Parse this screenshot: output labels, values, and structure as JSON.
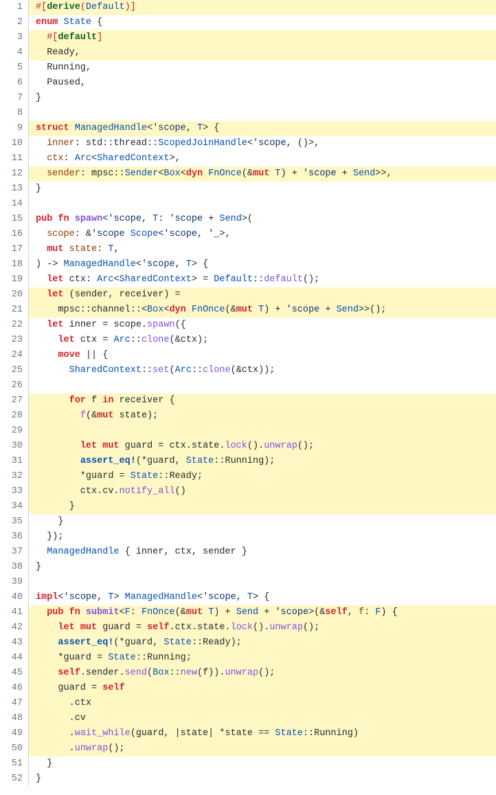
{
  "line_count": 52,
  "highlighted_lines": [
    1,
    3,
    4,
    9,
    12,
    20,
    21,
    27,
    28,
    29,
    30,
    31,
    32,
    33,
    34,
    41,
    42,
    43,
    44,
    45,
    46,
    47,
    48,
    49,
    50
  ],
  "lines": [
    {
      "n": 1,
      "t": [
        {
          "v": "a",
          "s": "#["
        },
        {
          "v": "f",
          "s": "derive"
        },
        {
          "v": "a",
          "s": "("
        },
        {
          "v": "c",
          "s": "Default"
        },
        {
          "v": "a",
          "s": ")]"
        }
      ]
    },
    {
      "n": 2,
      "t": [
        {
          "v": "b",
          "s": "enum"
        },
        {
          "s": " "
        },
        {
          "v": "c",
          "s": "State"
        },
        {
          "s": " {"
        }
      ]
    },
    {
      "n": 3,
      "t": [
        {
          "s": "  "
        },
        {
          "v": "a",
          "s": "#["
        },
        {
          "v": "f",
          "s": "default"
        },
        {
          "v": "a",
          "s": "]"
        }
      ]
    },
    {
      "n": 4,
      "t": [
        {
          "s": "  Ready,"
        }
      ]
    },
    {
      "n": 5,
      "t": [
        {
          "s": "  Running,"
        }
      ]
    },
    {
      "n": 6,
      "t": [
        {
          "s": "  Paused,"
        }
      ]
    },
    {
      "n": 7,
      "t": [
        {
          "s": "}"
        }
      ]
    },
    {
      "n": 8,
      "t": [
        {
          "s": ""
        }
      ]
    },
    {
      "n": 9,
      "t": [
        {
          "v": "b",
          "s": "struct"
        },
        {
          "s": " "
        },
        {
          "v": "c",
          "s": "ManagedHandle"
        },
        {
          "s": "<"
        },
        {
          "v": "h",
          "s": "'scope"
        },
        {
          "s": ", "
        },
        {
          "v": "c",
          "s": "T"
        },
        {
          "s": "> {"
        }
      ]
    },
    {
      "n": 10,
      "t": [
        {
          "s": "  "
        },
        {
          "v": "g",
          "s": "inner"
        },
        {
          "s": ": std::thread::"
        },
        {
          "v": "c",
          "s": "ScopedJoinHandle"
        },
        {
          "s": "<"
        },
        {
          "v": "h",
          "s": "'scope"
        },
        {
          "s": ", ()>,"
        }
      ]
    },
    {
      "n": 11,
      "t": [
        {
          "s": "  "
        },
        {
          "v": "g",
          "s": "ctx"
        },
        {
          "s": ": "
        },
        {
          "v": "c",
          "s": "Arc"
        },
        {
          "s": "<"
        },
        {
          "v": "c",
          "s": "SharedContext"
        },
        {
          "s": ">,"
        }
      ]
    },
    {
      "n": 12,
      "t": [
        {
          "s": "  "
        },
        {
          "v": "g",
          "s": "sender"
        },
        {
          "s": ": mpsc::"
        },
        {
          "v": "c",
          "s": "Sender"
        },
        {
          "s": "<"
        },
        {
          "v": "c",
          "s": "Box"
        },
        {
          "s": "<"
        },
        {
          "v": "b",
          "s": "dyn"
        },
        {
          "s": " "
        },
        {
          "v": "c",
          "s": "FnOnce"
        },
        {
          "s": "(&"
        },
        {
          "v": "b",
          "s": "mut"
        },
        {
          "s": " "
        },
        {
          "v": "c",
          "s": "T"
        },
        {
          "s": ") + "
        },
        {
          "v": "h",
          "s": "'scope"
        },
        {
          "s": " + "
        },
        {
          "v": "c",
          "s": "Send"
        },
        {
          "s": ">>,"
        }
      ]
    },
    {
      "n": 13,
      "t": [
        {
          "s": "}"
        }
      ]
    },
    {
      "n": 14,
      "t": [
        {
          "s": ""
        }
      ]
    },
    {
      "n": 15,
      "t": [
        {
          "v": "b",
          "s": "pub"
        },
        {
          "s": " "
        },
        {
          "v": "b",
          "s": "fn"
        },
        {
          "s": " "
        },
        {
          "v": "d",
          "s": "spawn"
        },
        {
          "s": "<"
        },
        {
          "v": "h",
          "s": "'scope"
        },
        {
          "s": ", "
        },
        {
          "v": "c",
          "s": "T"
        },
        {
          "s": ": "
        },
        {
          "v": "h",
          "s": "'scope"
        },
        {
          "s": " + "
        },
        {
          "v": "c",
          "s": "Send"
        },
        {
          "s": ">("
        }
      ]
    },
    {
      "n": 16,
      "t": [
        {
          "s": "  "
        },
        {
          "v": "g",
          "s": "scope"
        },
        {
          "s": ": &"
        },
        {
          "v": "h",
          "s": "'scope"
        },
        {
          "s": " "
        },
        {
          "v": "c",
          "s": "Scope"
        },
        {
          "s": "<"
        },
        {
          "v": "h",
          "s": "'scope"
        },
        {
          "s": ", "
        },
        {
          "v": "h",
          "s": "'_"
        },
        {
          "s": ">,"
        }
      ]
    },
    {
      "n": 17,
      "t": [
        {
          "s": "  "
        },
        {
          "v": "b",
          "s": "mut"
        },
        {
          "s": " "
        },
        {
          "v": "g",
          "s": "state"
        },
        {
          "s": ": "
        },
        {
          "v": "c",
          "s": "T"
        },
        {
          "s": ","
        }
      ]
    },
    {
      "n": 18,
      "t": [
        {
          "s": ") -> "
        },
        {
          "v": "c",
          "s": "ManagedHandle"
        },
        {
          "s": "<"
        },
        {
          "v": "h",
          "s": "'scope"
        },
        {
          "s": ", "
        },
        {
          "v": "c",
          "s": "T"
        },
        {
          "s": "> {"
        }
      ]
    },
    {
      "n": 19,
      "t": [
        {
          "s": "  "
        },
        {
          "v": "b",
          "s": "let"
        },
        {
          "s": " ctx: "
        },
        {
          "v": "c",
          "s": "Arc"
        },
        {
          "s": "<"
        },
        {
          "v": "c",
          "s": "SharedContext"
        },
        {
          "s": "> = "
        },
        {
          "v": "c",
          "s": "Default"
        },
        {
          "s": "::"
        },
        {
          "v": "e",
          "s": "default"
        },
        {
          "s": "();"
        }
      ]
    },
    {
      "n": 20,
      "t": [
        {
          "s": "  "
        },
        {
          "v": "b",
          "s": "let"
        },
        {
          "s": " (sender, receiver) ="
        }
      ]
    },
    {
      "n": 21,
      "t": [
        {
          "s": "    mpsc::channel::<"
        },
        {
          "v": "c",
          "s": "Box"
        },
        {
          "s": "<"
        },
        {
          "v": "b",
          "s": "dyn"
        },
        {
          "s": " "
        },
        {
          "v": "c",
          "s": "FnOnce"
        },
        {
          "s": "(&"
        },
        {
          "v": "b",
          "s": "mut"
        },
        {
          "s": " "
        },
        {
          "v": "c",
          "s": "T"
        },
        {
          "s": ") + "
        },
        {
          "v": "h",
          "s": "'scope"
        },
        {
          "s": " + "
        },
        {
          "v": "c",
          "s": "Send"
        },
        {
          "s": ">>();"
        }
      ]
    },
    {
      "n": 22,
      "t": [
        {
          "s": "  "
        },
        {
          "v": "b",
          "s": "let"
        },
        {
          "s": " inner = scope."
        },
        {
          "v": "e",
          "s": "spawn"
        },
        {
          "s": "({"
        }
      ]
    },
    {
      "n": 23,
      "t": [
        {
          "s": "    "
        },
        {
          "v": "b",
          "s": "let"
        },
        {
          "s": " ctx = "
        },
        {
          "v": "c",
          "s": "Arc"
        },
        {
          "s": "::"
        },
        {
          "v": "e",
          "s": "clone"
        },
        {
          "s": "(&ctx);"
        }
      ]
    },
    {
      "n": 24,
      "t": [
        {
          "s": "    "
        },
        {
          "v": "b",
          "s": "move"
        },
        {
          "s": " || {"
        }
      ]
    },
    {
      "n": 25,
      "t": [
        {
          "s": "      "
        },
        {
          "v": "c",
          "s": "SharedContext"
        },
        {
          "s": "::"
        },
        {
          "v": "e",
          "s": "set"
        },
        {
          "s": "("
        },
        {
          "v": "c",
          "s": "Arc"
        },
        {
          "s": "::"
        },
        {
          "v": "e",
          "s": "clone"
        },
        {
          "s": "(&ctx));"
        }
      ]
    },
    {
      "n": 26,
      "t": [
        {
          "s": ""
        }
      ]
    },
    {
      "n": 27,
      "t": [
        {
          "s": "      "
        },
        {
          "v": "b",
          "s": "for"
        },
        {
          "s": " f "
        },
        {
          "v": "b",
          "s": "in"
        },
        {
          "s": " receiver {"
        }
      ]
    },
    {
      "n": 28,
      "t": [
        {
          "s": "        "
        },
        {
          "v": "e",
          "s": "f"
        },
        {
          "s": "(&"
        },
        {
          "v": "b",
          "s": "mut"
        },
        {
          "s": " state);"
        }
      ]
    },
    {
      "n": 29,
      "t": [
        {
          "s": ""
        }
      ]
    },
    {
      "n": 30,
      "t": [
        {
          "s": "        "
        },
        {
          "v": "b",
          "s": "let"
        },
        {
          "s": " "
        },
        {
          "v": "b",
          "s": "mut"
        },
        {
          "s": " guard = ctx.state."
        },
        {
          "v": "e",
          "s": "lock"
        },
        {
          "s": "()."
        },
        {
          "v": "e",
          "s": "unwrap"
        },
        {
          "s": "();"
        }
      ]
    },
    {
      "n": 31,
      "t": [
        {
          "s": "        "
        },
        {
          "v": "i",
          "s": "assert_eq!"
        },
        {
          "s": "(*guard, "
        },
        {
          "v": "c",
          "s": "State"
        },
        {
          "s": "::Running);"
        }
      ]
    },
    {
      "n": 32,
      "t": [
        {
          "s": "        *guard = "
        },
        {
          "v": "c",
          "s": "State"
        },
        {
          "s": "::Ready;"
        }
      ]
    },
    {
      "n": 33,
      "t": [
        {
          "s": "        ctx.cv."
        },
        {
          "v": "e",
          "s": "notify_all"
        },
        {
          "s": "()"
        }
      ]
    },
    {
      "n": 34,
      "t": [
        {
          "s": "      }"
        }
      ]
    },
    {
      "n": 35,
      "t": [
        {
          "s": "    }"
        }
      ]
    },
    {
      "n": 36,
      "t": [
        {
          "s": "  });"
        }
      ]
    },
    {
      "n": 37,
      "t": [
        {
          "s": "  "
        },
        {
          "v": "c",
          "s": "ManagedHandle"
        },
        {
          "s": " { inner, ctx, sender }"
        }
      ]
    },
    {
      "n": 38,
      "t": [
        {
          "s": "}"
        }
      ]
    },
    {
      "n": 39,
      "t": [
        {
          "s": ""
        }
      ]
    },
    {
      "n": 40,
      "t": [
        {
          "v": "b",
          "s": "impl"
        },
        {
          "s": "<"
        },
        {
          "v": "h",
          "s": "'scope"
        },
        {
          "s": ", "
        },
        {
          "v": "c",
          "s": "T"
        },
        {
          "s": "> "
        },
        {
          "v": "c",
          "s": "ManagedHandle"
        },
        {
          "s": "<"
        },
        {
          "v": "h",
          "s": "'scope"
        },
        {
          "s": ", "
        },
        {
          "v": "c",
          "s": "T"
        },
        {
          "s": "> {"
        }
      ]
    },
    {
      "n": 41,
      "t": [
        {
          "s": "  "
        },
        {
          "v": "b",
          "s": "pub"
        },
        {
          "s": " "
        },
        {
          "v": "b",
          "s": "fn"
        },
        {
          "s": " "
        },
        {
          "v": "d",
          "s": "submit"
        },
        {
          "s": "<"
        },
        {
          "v": "c",
          "s": "F"
        },
        {
          "s": ": "
        },
        {
          "v": "c",
          "s": "FnOnce"
        },
        {
          "s": "(&"
        },
        {
          "v": "b",
          "s": "mut"
        },
        {
          "s": " "
        },
        {
          "v": "c",
          "s": "T"
        },
        {
          "s": ") + "
        },
        {
          "v": "c",
          "s": "Send"
        },
        {
          "s": " + "
        },
        {
          "v": "h",
          "s": "'scope"
        },
        {
          "s": ">(&"
        },
        {
          "v": "b",
          "s": "self"
        },
        {
          "s": ", "
        },
        {
          "v": "g",
          "s": "f"
        },
        {
          "s": ": "
        },
        {
          "v": "c",
          "s": "F"
        },
        {
          "s": ") {"
        }
      ]
    },
    {
      "n": 42,
      "t": [
        {
          "s": "    "
        },
        {
          "v": "b",
          "s": "let"
        },
        {
          "s": " "
        },
        {
          "v": "b",
          "s": "mut"
        },
        {
          "s": " guard = "
        },
        {
          "v": "b",
          "s": "self"
        },
        {
          "s": ".ctx.state."
        },
        {
          "v": "e",
          "s": "lock"
        },
        {
          "s": "()."
        },
        {
          "v": "e",
          "s": "unwrap"
        },
        {
          "s": "();"
        }
      ]
    },
    {
      "n": 43,
      "t": [
        {
          "s": "    "
        },
        {
          "v": "i",
          "s": "assert_eq!"
        },
        {
          "s": "(*guard, "
        },
        {
          "v": "c",
          "s": "State"
        },
        {
          "s": "::Ready);"
        }
      ]
    },
    {
      "n": 44,
      "t": [
        {
          "s": "    *guard = "
        },
        {
          "v": "c",
          "s": "State"
        },
        {
          "s": "::Running;"
        }
      ]
    },
    {
      "n": 45,
      "t": [
        {
          "s": "    "
        },
        {
          "v": "b",
          "s": "self"
        },
        {
          "s": ".sender."
        },
        {
          "v": "e",
          "s": "send"
        },
        {
          "s": "("
        },
        {
          "v": "c",
          "s": "Box"
        },
        {
          "s": "::"
        },
        {
          "v": "e",
          "s": "new"
        },
        {
          "s": "(f))."
        },
        {
          "v": "e",
          "s": "unwrap"
        },
        {
          "s": "();"
        }
      ]
    },
    {
      "n": 46,
      "t": [
        {
          "s": "    guard = "
        },
        {
          "v": "b",
          "s": "self"
        }
      ]
    },
    {
      "n": 47,
      "t": [
        {
          "s": "      .ctx"
        }
      ]
    },
    {
      "n": 48,
      "t": [
        {
          "s": "      .cv"
        }
      ]
    },
    {
      "n": 49,
      "t": [
        {
          "s": "      ."
        },
        {
          "v": "e",
          "s": "wait_while"
        },
        {
          "s": "(guard, |state| *state == "
        },
        {
          "v": "c",
          "s": "State"
        },
        {
          "s": "::Running)"
        }
      ]
    },
    {
      "n": 50,
      "t": [
        {
          "s": "      ."
        },
        {
          "v": "e",
          "s": "unwrap"
        },
        {
          "s": "();"
        }
      ]
    },
    {
      "n": 51,
      "t": [
        {
          "s": "  }"
        }
      ]
    },
    {
      "n": 52,
      "t": [
        {
          "s": "}"
        }
      ]
    }
  ]
}
